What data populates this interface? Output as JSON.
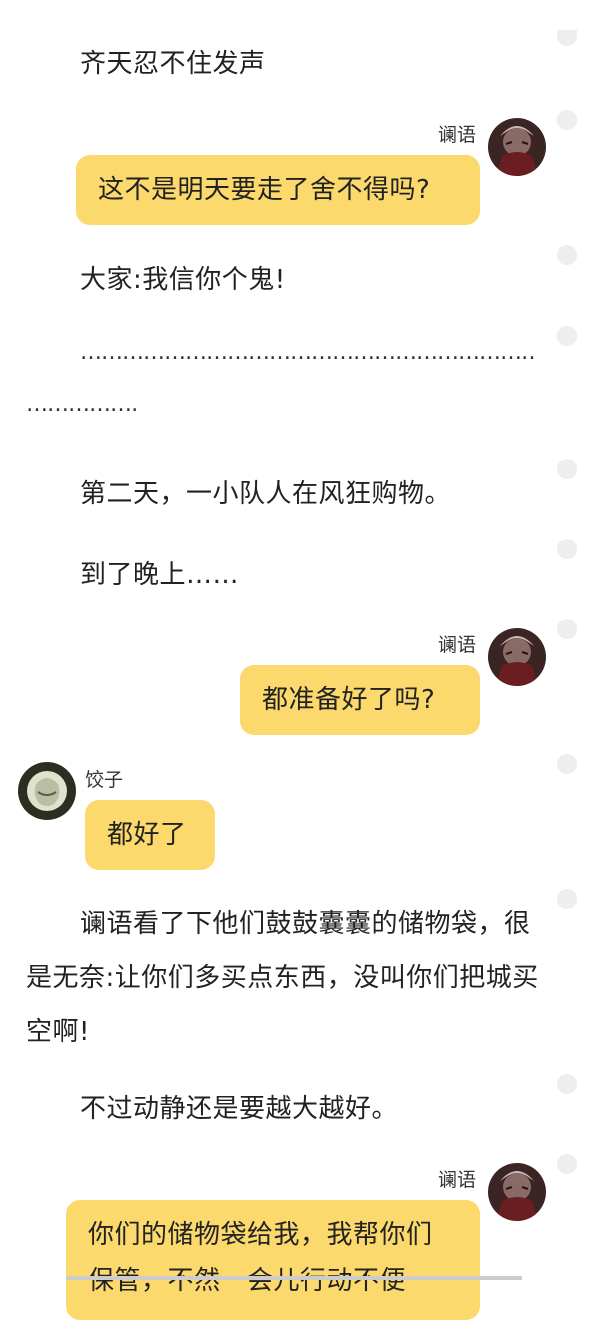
{
  "story": {
    "p1": "齐天忍不住发声",
    "msg1": {
      "speaker": "谰语",
      "text": "这不是明天要走了舍不得吗?"
    },
    "p2": "大家:我信你个鬼!",
    "dots_line1": "…………………………………………………………………",
    "dots_line2": "………………",
    "p3": "第二天，一小队人在风狂购物。",
    "p4": "到了晚上……",
    "msg2": {
      "speaker": "谰语",
      "text": "都准备好了吗?"
    },
    "msg3": {
      "speaker": "饺子",
      "text": "都好了"
    },
    "p5": "谰语看了下他们鼓鼓囊囊的储物袋，很是无奈:让你们多买点东西，没叫你们把城买空啊!",
    "p6": "不过动静还是要越大越好。",
    "msg4": {
      "speaker": "谰语",
      "text": "你们的储物袋给我，我帮你们保管，不然一会儿行动不便"
    }
  },
  "colors": {
    "bubble": "#fbd96c",
    "comment_dot": "#eeeeee",
    "text": "#222222"
  },
  "icons": {
    "avatar_lanyu": "dark-red-character-portrait",
    "avatar_jiaozi": "green-sketch-portrait",
    "comment_dot": "comment-dot-icon"
  }
}
